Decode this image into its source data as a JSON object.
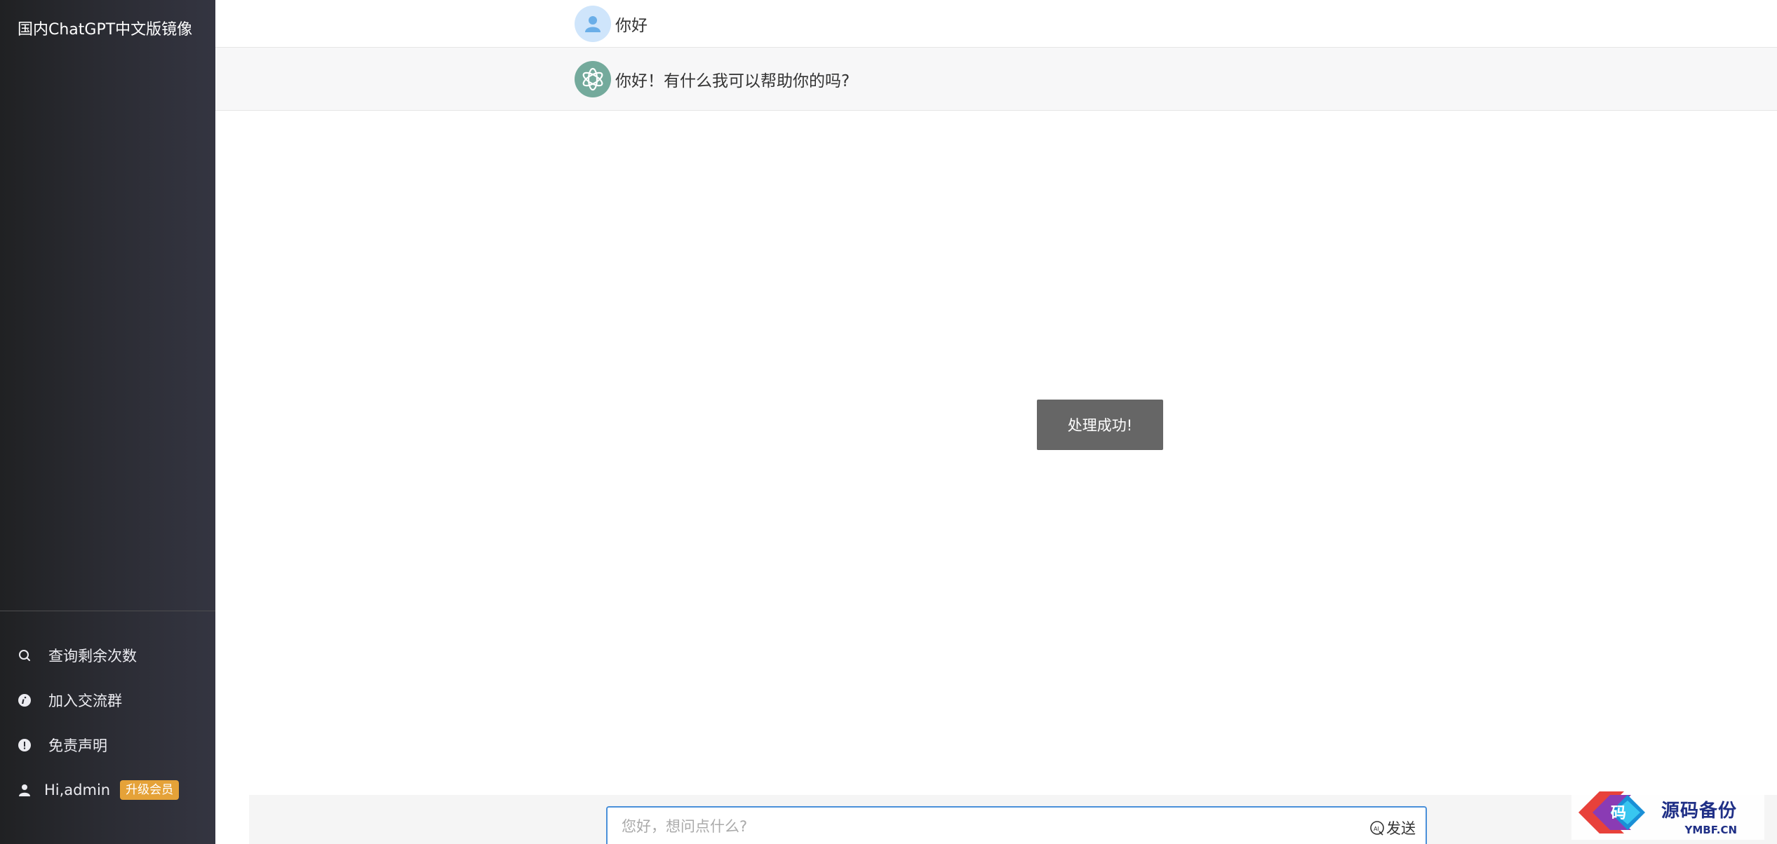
{
  "sidebar": {
    "brand": "国内ChatGPT中文版镜像",
    "items": [
      {
        "label": "查询剩余次数",
        "icon": "search-icon"
      },
      {
        "label": "加入交流群",
        "icon": "info-icon"
      },
      {
        "label": "免责声明",
        "icon": "alert-icon"
      }
    ],
    "user": {
      "greeting": "Hi,admin",
      "badge": "升级会员",
      "icon": "user-icon"
    }
  },
  "chat": {
    "messages": [
      {
        "role": "user",
        "text": "你好"
      },
      {
        "role": "assistant",
        "text": "你好！有什么我可以帮助你的吗?"
      }
    ]
  },
  "toast": {
    "text": "处理成功!"
  },
  "composer": {
    "placeholder": "您好，想问点什么?",
    "send_label": "发送",
    "send_icon": "ai-send-icon"
  },
  "watermark": {
    "title": "源码备份",
    "subtitle": "YMBF.CN",
    "glyph": "码"
  },
  "colors": {
    "sidebar_bg": "#202123",
    "bot_row_bg": "#f7f7f8",
    "bot_avatar": "#74aa9c",
    "user_avatar": "#cfe5fb",
    "badge": "#e5a238",
    "toast_bg": "#666666",
    "input_border": "#4a90d9"
  }
}
